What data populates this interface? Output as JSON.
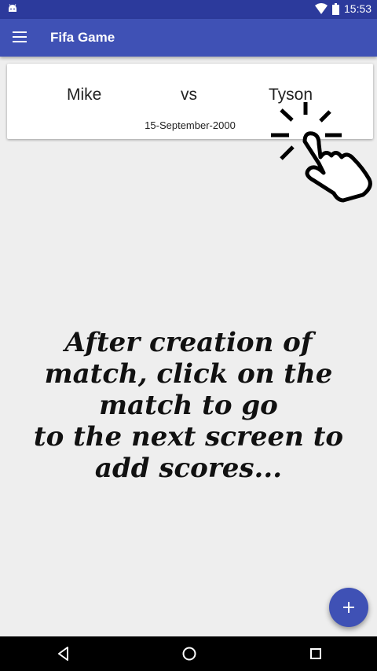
{
  "status_bar": {
    "time": "15:53",
    "icons": [
      "android-icon",
      "wifi-icon",
      "battery-icon"
    ]
  },
  "app_bar": {
    "menu_icon": "menu-icon",
    "title": "Fifa Game"
  },
  "match": {
    "home_player": "Mike",
    "vs_label": "vs",
    "away_player": "Tyson",
    "date": "15-September-2000"
  },
  "overlay": {
    "hand_icon": "tap-hand-icon",
    "lines": [
      "After creation of",
      "match, click on the",
      "match to go",
      "to the next screen to",
      "add scores..."
    ]
  },
  "fab": {
    "icon": "plus-icon"
  },
  "nav_bar": {
    "icons": [
      "back-icon",
      "home-icon",
      "recents-icon"
    ]
  },
  "colors": {
    "status_bar": "#2c3a9c",
    "app_bar": "#3f51b5",
    "background": "#eeeeee",
    "fab": "#3f51b5"
  }
}
